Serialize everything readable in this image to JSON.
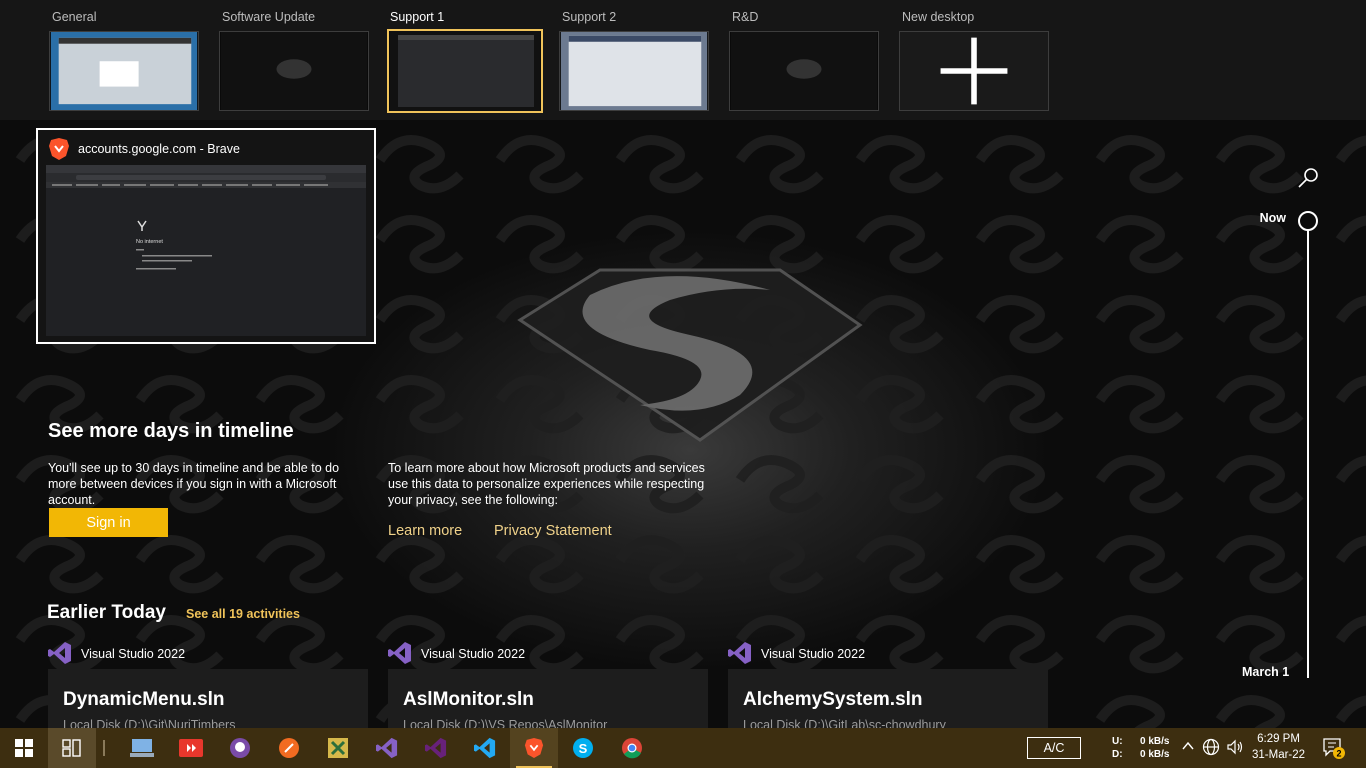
{
  "desktops": [
    {
      "label": "General",
      "active": false
    },
    {
      "label": "Software Update",
      "active": false
    },
    {
      "label": "Support 1",
      "active": true
    },
    {
      "label": "Support 2",
      "active": false
    },
    {
      "label": "R&D",
      "active": false
    },
    {
      "label": "New desktop",
      "active": false
    }
  ],
  "window": {
    "title": "accounts.google.com - Brave",
    "page_heading": "No internet"
  },
  "timeline": {
    "now_label": "Now",
    "date_label": "March 1"
  },
  "see_more": {
    "title": "See more days in timeline",
    "text": "You'll see up to 30 days in timeline and be able to do more between devices if you sign in with a Microsoft account.",
    "sign_in_label": "Sign in",
    "privacy_text": "To learn more about how Microsoft products and services use this data to personalize experiences while respecting your privacy, see the following:",
    "learn_more": "Learn more",
    "privacy_statement": "Privacy Statement"
  },
  "earlier": {
    "title": "Earlier Today",
    "see_all": "See all 19 activities"
  },
  "activities": [
    {
      "app": "Visual Studio 2022",
      "name": "DynamicMenu.sln",
      "path": "Local Disk (D:)\\Git\\NuriTimbers"
    },
    {
      "app": "Visual Studio 2022",
      "name": "AslMonitor.sln",
      "path": "Local Disk (D:)\\VS Repos\\AslMonitor"
    },
    {
      "app": "Visual Studio 2022",
      "name": "AlchemySystem.sln",
      "path": "Local Disk (D:)\\GitLab\\sc-chowdhury"
    }
  ],
  "taskbar": {
    "ac_label": "A/C",
    "net_up_label": "U:",
    "net_down_label": "D:",
    "net_up": "0 kB/s",
    "net_down": "0 kB/s",
    "time": "6:29 PM",
    "date": "31-Mar-22",
    "notification_count": "2"
  },
  "colors": {
    "accent": "#f2b705",
    "taskbar": "#3d2e10"
  }
}
